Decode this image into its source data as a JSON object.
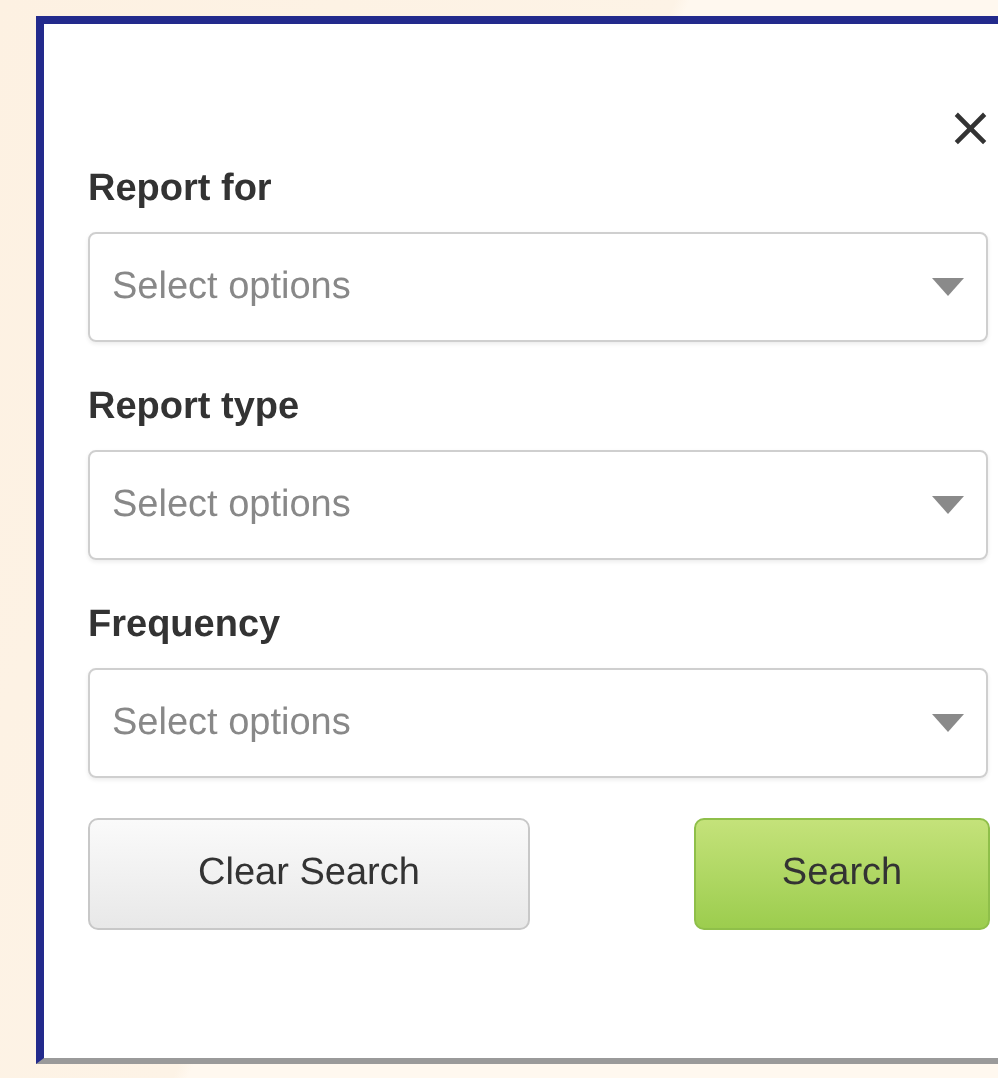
{
  "close": "×",
  "fields": [
    {
      "label": "Report for",
      "placeholder": "Select options"
    },
    {
      "label": "Report type",
      "placeholder": "Select options"
    },
    {
      "label": "Frequency",
      "placeholder": "Select options"
    }
  ],
  "buttons": [
    {
      "label": "Clear Search",
      "kind": "secondary"
    },
    {
      "label": "Search",
      "kind": "primary"
    }
  ]
}
